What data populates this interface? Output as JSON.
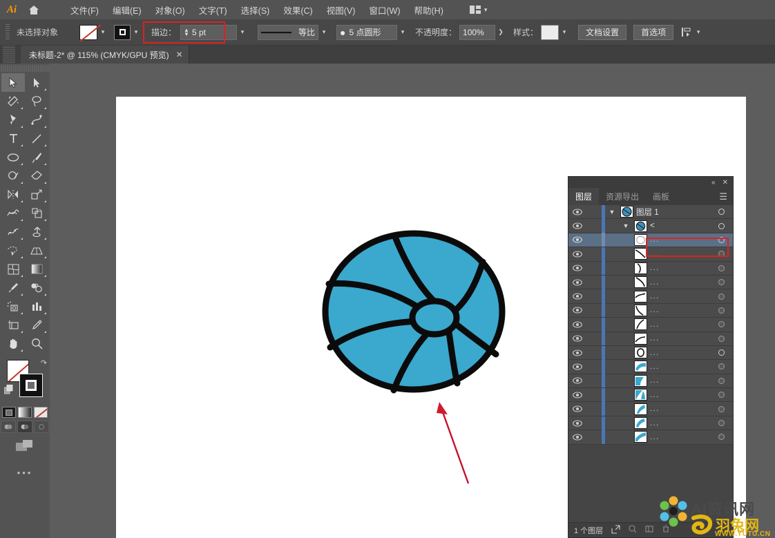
{
  "app": {
    "logo": "Ai",
    "home_icon": "home-icon"
  },
  "menubar": {
    "items": [
      {
        "label": "文件(F)"
      },
      {
        "label": "编辑(E)"
      },
      {
        "label": "对象(O)"
      },
      {
        "label": "文字(T)"
      },
      {
        "label": "选择(S)"
      },
      {
        "label": "效果(C)"
      },
      {
        "label": "视图(V)"
      },
      {
        "label": "窗口(W)"
      },
      {
        "label": "帮助(H)"
      }
    ],
    "arrange_label": ""
  },
  "options": {
    "selection_status": "未选择对象",
    "fill_swatch": "none-swatch",
    "stroke_swatch": "black-stroke-swatch",
    "stroke_label": "描边：",
    "stroke_value": "5 pt",
    "profile_label": "等比",
    "brush_label": "5 点圆形",
    "opacity_label": "不透明度：",
    "opacity_value": "100%",
    "style_label": "样式：",
    "doc_setup": "文档设置",
    "preferences": "首选项",
    "align_icon": "align-icon"
  },
  "tab": {
    "title": "未标题-2* @ 115% (CMYK/GPU 预览)",
    "close": "✕"
  },
  "toolbar": {
    "tools": [
      {
        "name": "selection-tool",
        "active": true
      },
      {
        "name": "direct-selection-tool",
        "active": false
      },
      {
        "name": "magic-wand-tool",
        "active": false
      },
      {
        "name": "lasso-tool",
        "active": false
      },
      {
        "name": "pen-tool",
        "active": false
      },
      {
        "name": "curvature-tool",
        "active": false
      },
      {
        "name": "type-tool",
        "active": false
      },
      {
        "name": "line-segment-tool",
        "active": false
      },
      {
        "name": "ellipse-tool",
        "active": false
      },
      {
        "name": "paintbrush-tool",
        "active": false
      },
      {
        "name": "shaper-tool",
        "active": false
      },
      {
        "name": "eraser-tool",
        "active": false
      },
      {
        "name": "rotate-tool",
        "active": false
      },
      {
        "name": "scale-tool",
        "active": false
      },
      {
        "name": "width-tool",
        "active": false
      },
      {
        "name": "free-transform-tool",
        "active": false
      },
      {
        "name": "shape-builder-tool",
        "active": false
      },
      {
        "name": "perspective-grid-tool",
        "active": false
      },
      {
        "name": "mesh-tool",
        "active": false
      },
      {
        "name": "gradient-tool",
        "active": false
      },
      {
        "name": "eyedropper-tool",
        "active": false
      },
      {
        "name": "blend-tool",
        "active": false
      },
      {
        "name": "symbol-sprayer-tool",
        "active": false
      },
      {
        "name": "column-graph-tool",
        "active": false
      },
      {
        "name": "artboard-tool",
        "active": false
      },
      {
        "name": "slice-tool",
        "active": false
      },
      {
        "name": "hand-tool",
        "active": false
      },
      {
        "name": "zoom-tool",
        "active": false
      }
    ],
    "fill_state": "none",
    "stroke_state": "black",
    "more_tools": "•••"
  },
  "canvas": {
    "artwork_name": "beach-ball-illustration",
    "ball_fill_color": "#3ba8ce",
    "ball_stroke_color": "#0b0b0b"
  },
  "annotations": {
    "arrow_color": "#c8102e",
    "box_color": "#e02020"
  },
  "layers_panel": {
    "tabs": [
      {
        "label": "图层",
        "active": true
      },
      {
        "label": "资源导出",
        "active": false
      },
      {
        "label": "画板",
        "active": false
      }
    ],
    "collapse_icon": "collapse-icon",
    "close_icon": "close-icon",
    "menu_icon": "panel-menu-icon",
    "rows": [
      {
        "name": "图层 1",
        "indent": 0,
        "twisty": "v",
        "thumb": "ball-thumb",
        "selected": false,
        "target": "hollow"
      },
      {
        "name": "<",
        "indent": 1,
        "twisty": "v",
        "thumb": "group-thumb",
        "selected": false,
        "target": "hollow"
      },
      {
        "name": "...",
        "indent": 2,
        "twisty": "",
        "thumb": "ellipse-path",
        "selected": true,
        "target": "hollow"
      },
      {
        "name": "...",
        "indent": 2,
        "twisty": "",
        "thumb": "curve-path-1",
        "selected": false,
        "target": "filled"
      },
      {
        "name": "...",
        "indent": 2,
        "twisty": "",
        "thumb": "curve-path-2",
        "selected": false,
        "target": "filled"
      },
      {
        "name": "...",
        "indent": 2,
        "twisty": "",
        "thumb": "curve-path-3",
        "selected": false,
        "target": "filled"
      },
      {
        "name": "...",
        "indent": 2,
        "twisty": "",
        "thumb": "curve-path-4",
        "selected": false,
        "target": "filled"
      },
      {
        "name": "...",
        "indent": 2,
        "twisty": "",
        "thumb": "curve-path-5",
        "selected": false,
        "target": "filled"
      },
      {
        "name": "...",
        "indent": 2,
        "twisty": "",
        "thumb": "curve-path-6",
        "selected": false,
        "target": "filled"
      },
      {
        "name": "...",
        "indent": 2,
        "twisty": "",
        "thumb": "curve-path-7",
        "selected": false,
        "target": "filled"
      },
      {
        "name": "...",
        "indent": 2,
        "twisty": "",
        "thumb": "ellipse-outline",
        "selected": false,
        "target": "hollow"
      },
      {
        "name": "...",
        "indent": 2,
        "twisty": "",
        "thumb": "blue-shape-1",
        "selected": false,
        "target": "filled"
      },
      {
        "name": "...",
        "indent": 2,
        "twisty": "",
        "thumb": "blue-shape-2",
        "selected": false,
        "target": "filled"
      },
      {
        "name": "...",
        "indent": 2,
        "twisty": "",
        "thumb": "blue-shape-3",
        "selected": false,
        "target": "filled"
      },
      {
        "name": "...",
        "indent": 2,
        "twisty": "",
        "thumb": "blue-shape-4",
        "selected": false,
        "target": "filled"
      },
      {
        "name": "...",
        "indent": 2,
        "twisty": "",
        "thumb": "blue-shape-5",
        "selected": false,
        "target": "filled"
      },
      {
        "name": "...",
        "indent": 2,
        "twisty": "",
        "thumb": "blue-shape-6",
        "selected": false,
        "target": "filled"
      }
    ],
    "status_text": "1 个图层",
    "footer_icons": [
      "locate-object-icon",
      "new-sublayer-icon",
      "new-layer-icon",
      "delete-layer-icon"
    ]
  },
  "watermarks": {
    "primary": "AI资讯网",
    "secondary": "羽兔网",
    "url": "WWW.YUTU.CN"
  }
}
